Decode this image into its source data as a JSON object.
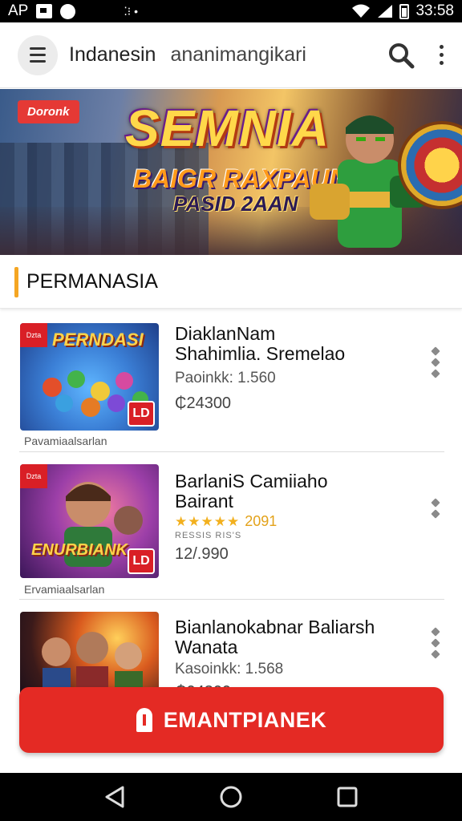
{
  "status_bar": {
    "carrier": "AP",
    "dots": "⁚⁝ •",
    "time": "33:58"
  },
  "app_bar": {
    "title": "Indanesin",
    "subtitle": "ananimangikari"
  },
  "banner": {
    "tag": "Doronk",
    "title": "SEMNIA",
    "subtitle_1": "BAIGR RAXPAUNS",
    "subtitle_2": "PASID 2AAN"
  },
  "section": {
    "title": "PERMANASIA"
  },
  "items": [
    {
      "title_line1": "DiaklanNam",
      "title_line2": "Shahimlia. Sremelao",
      "meta": "Paoinkk: 1.560",
      "price": "₵24300",
      "thumb_title": "PERNDASI",
      "thumb_ribbon": "Dzta",
      "thumb_badge": "LD",
      "caption": "Pavamiaalsarlan"
    },
    {
      "title_line1": "BarlaniS Camiiaho",
      "title_line2": "Bairant",
      "stars": "★★★★★",
      "rating_count": "2091",
      "small_text": "RESSIS RIS'S",
      "price": "12/.990",
      "thumb_title": "ENURBIANK",
      "thumb_ribbon": "Dzta",
      "thumb_badge": "LD",
      "caption": "Ervamiaalsarlan"
    },
    {
      "title_line1": "Bianlanokabnar Baliarsh",
      "title_line2": "Wanata",
      "meta": "Kasoinkk: 1.568",
      "price": "₵04300"
    }
  ],
  "cta": {
    "label": "EMANTPIANEK"
  },
  "icons": {
    "menu": "menu-icon",
    "search": "search-icon",
    "more": "more-vert-icon",
    "back": "back-triangle-icon",
    "home": "home-circle-icon",
    "recents": "recents-square-icon"
  },
  "colors": {
    "accent_red": "#e42a24",
    "section_accent": "#f5a623",
    "star": "#f2b01e"
  }
}
